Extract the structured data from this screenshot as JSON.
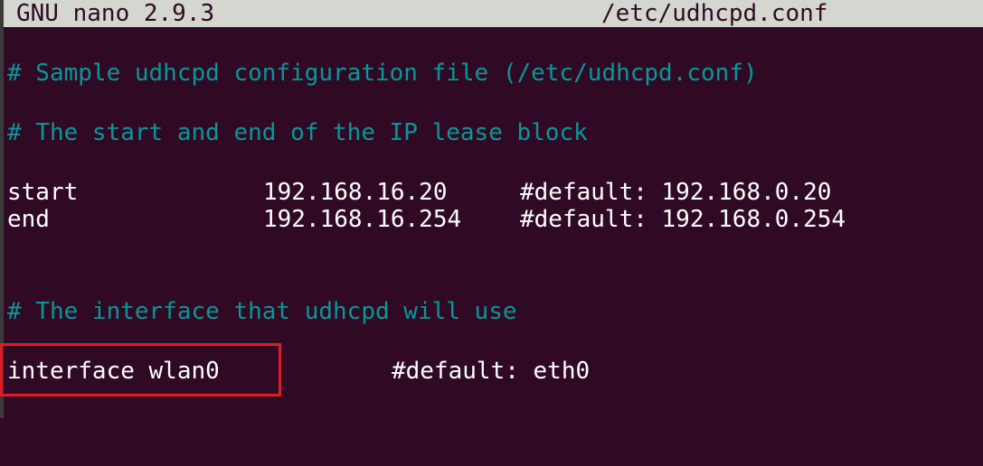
{
  "titlebar": {
    "app": "GNU nano 2.9.3",
    "file": "/etc/udhcpd.conf"
  },
  "lines": {
    "comment_sample": "# Sample udhcpd configuration file (/etc/udhcpd.conf)",
    "comment_lease": "# The start and end of the IP lease block",
    "start": {
      "key": "start",
      "value": "192.168.16.20",
      "comment": "#default: 192.168.0.20"
    },
    "end": {
      "key": "end",
      "value": "192.168.16.254",
      "comment": "#default: 192.168.0.254"
    },
    "comment_interface": "# The interface that udhcpd will use",
    "interface": {
      "key": "interface wlan0",
      "comment": "#default: eth0"
    }
  },
  "colors": {
    "background": "#300a24",
    "titlebar": "#d3d7cf",
    "comment": "#06989a",
    "text": "#ffffff",
    "highlight": "#e01b24"
  }
}
